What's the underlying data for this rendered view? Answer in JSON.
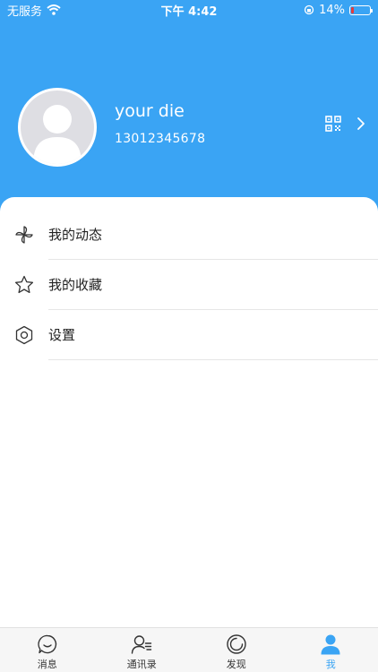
{
  "status_bar": {
    "carrier": "无服务",
    "time": "下午 4:42",
    "battery_percent": "14%",
    "battery_level": 0.14
  },
  "profile": {
    "name": "your die",
    "phone": "13012345678"
  },
  "menu": [
    {
      "label": "我的动态",
      "icon": "pinwheel-icon"
    },
    {
      "label": "我的收藏",
      "icon": "star-icon"
    },
    {
      "label": "设置",
      "icon": "hexagon-settings-icon"
    }
  ],
  "tabs": [
    {
      "label": "消息",
      "icon": "chat-bubble-icon",
      "active": false
    },
    {
      "label": "通讯录",
      "icon": "contacts-icon",
      "active": false
    },
    {
      "label": "发现",
      "icon": "discover-icon",
      "active": false
    },
    {
      "label": "我",
      "icon": "person-icon",
      "active": true
    }
  ],
  "colors": {
    "primary": "#3aa4f4",
    "battery_low": "#e63b3b"
  }
}
